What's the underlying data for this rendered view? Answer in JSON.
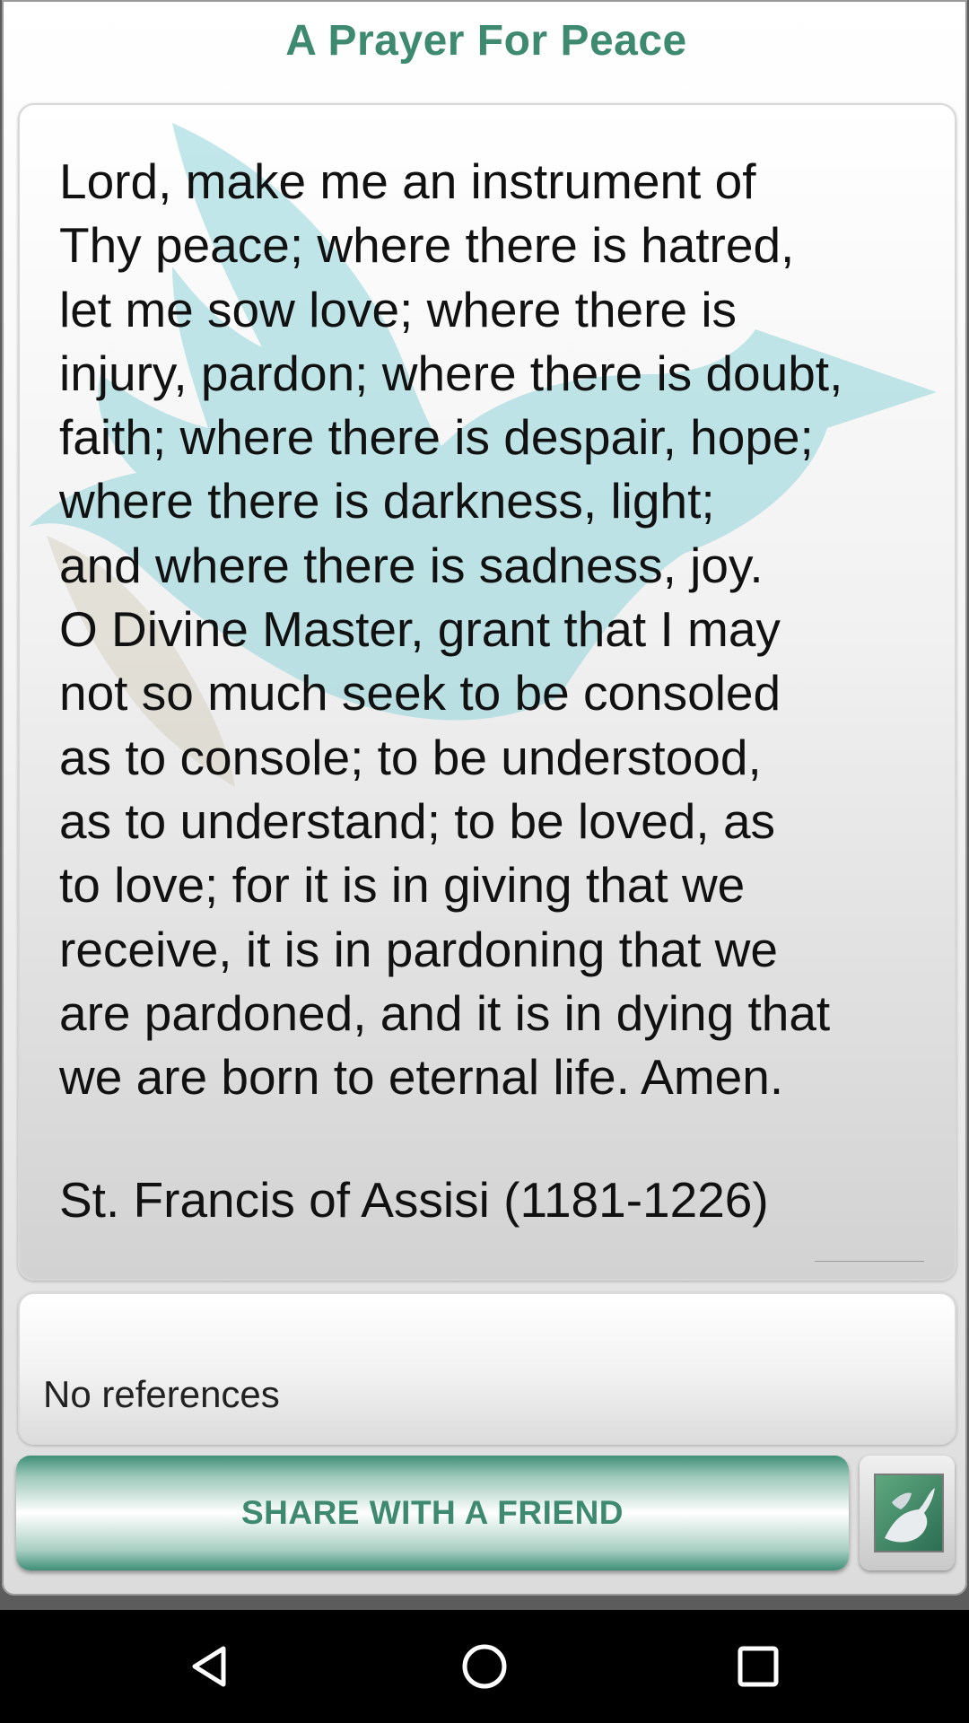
{
  "app": {
    "title": "A Prayer For Peace"
  },
  "prayer": {
    "text": "Lord, make me an instrument of\nThy peace; where there is hatred,\nlet me sow love; where there is\ninjury, pardon; where there is doubt,\nfaith; where there is despair, hope;\nwhere there is darkness, light;\nand where there is sadness, joy.\nO Divine Master, grant that I may\nnot so much seek to be consoled\nas to console; to be understood,\nas to understand; to be loved, as\nto love; for it is in giving that we\nreceive, it is in pardoning that we\nare pardoned, and it is in dying that\nwe are born to eternal life. Amen.",
    "attribution": "St. Francis of Assisi (1181-1226)",
    "watermark_icon": "dove-icon"
  },
  "references": {
    "text": "No references"
  },
  "actions": {
    "share_label": "SHARE WITH A FRIEND",
    "image_icon": "dove-image-icon"
  },
  "nav": {
    "back_icon": "back-icon",
    "home_icon": "home-icon",
    "recents_icon": "recents-icon"
  },
  "colors": {
    "accent": "#3e8a70",
    "watermark": "#8ed3d8"
  }
}
